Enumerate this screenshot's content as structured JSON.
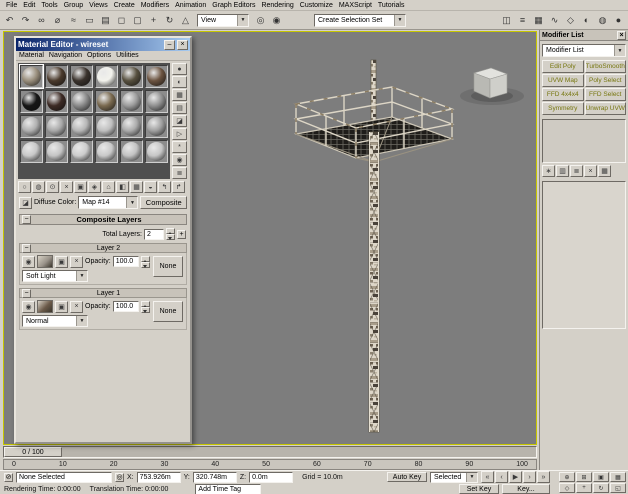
{
  "ui": {
    "dropdown_arrow": "▼"
  },
  "colors": {
    "titlebar_left": "#0a246a",
    "titlebar_right": "#a6caf0",
    "viewport_bg": "#7d7d7d",
    "active_viewport_border": "#c6c600",
    "modifier_button_text": "#77770f"
  },
  "menu": {
    "items": [
      "File",
      "Edit",
      "Tools",
      "Group",
      "Views",
      "Create",
      "Modifiers",
      "Animation",
      "Graph Editors",
      "Rendering",
      "Customize",
      "MAXScript",
      "Tutorials"
    ]
  },
  "toolbar": {
    "view_combo": "View",
    "selection_set_combo": "Create Selection Set",
    "left_icons": [
      {
        "name": "undo-icon",
        "glyph": "↶"
      },
      {
        "name": "redo-icon",
        "glyph": "↷"
      },
      {
        "name": "select-and-link-icon",
        "glyph": "∞"
      },
      {
        "name": "unlink-selection-icon",
        "glyph": "⌀"
      },
      {
        "name": "bind-to-space-warp-icon",
        "glyph": "≈"
      },
      {
        "name": "select-object-icon",
        "glyph": "▭"
      },
      {
        "name": "select-by-name-icon",
        "glyph": "▤"
      },
      {
        "name": "rectangular-selection-region-icon",
        "glyph": "◻"
      },
      {
        "name": "window-crossing-toggle-icon",
        "glyph": "▢"
      },
      {
        "name": "select-and-move-icon",
        "glyph": "+"
      },
      {
        "name": "select-and-rotate-icon",
        "glyph": "↻"
      },
      {
        "name": "select-and-scale-icon",
        "glyph": "△"
      }
    ],
    "mid_icons": [
      {
        "name": "use-pivot-point-icon",
        "glyph": "◎"
      },
      {
        "name": "select-and-manipulate-icon",
        "glyph": "◉"
      }
    ],
    "right_icons": [
      {
        "name": "mirror-icon",
        "glyph": "◫"
      },
      {
        "name": "align-icon",
        "glyph": "≡"
      },
      {
        "name": "layer-manager-icon",
        "glyph": "▦"
      },
      {
        "name": "curve-editor-icon",
        "glyph": "∿"
      },
      {
        "name": "schematic-view-icon",
        "glyph": "◇"
      },
      {
        "name": "material-editor-icon",
        "glyph": "◐"
      },
      {
        "name": "render-setup-icon",
        "glyph": "◍"
      },
      {
        "name": "quick-render-icon",
        "glyph": "●"
      }
    ]
  },
  "material_editor": {
    "title": "Material Editor - wireset",
    "min_glyph": "–",
    "close_glyph": "×",
    "collapse_glyph": "−",
    "menu": [
      "Material",
      "Navigation",
      "Options",
      "Utilities"
    ],
    "active_slot": 0,
    "slots": [
      "#9a8f7d",
      "#4a3a2c",
      "#3a322c",
      "#f2f2ec",
      "#57503f",
      "#6b5340",
      "#161616",
      "#3d2b25",
      "#8a8a8a",
      "#7a6a50",
      "#9c9c9c",
      "#909090",
      "#b0b0b0",
      "#a8a8a8",
      "#b6b6b6",
      "#bfbfbf",
      "#ababab",
      "#a0a0a0",
      "#c8c8c8",
      "#c4c4c4",
      "#cccccc",
      "#c9c9c9",
      "#c2c2c2",
      "#c6c6c6"
    ],
    "side_tools": [
      {
        "name": "sample-type-icon",
        "glyph": "●"
      },
      {
        "name": "backlight-icon",
        "glyph": "◐"
      },
      {
        "name": "background-icon",
        "glyph": "▦"
      },
      {
        "name": "sample-uv-tiling-icon",
        "glyph": "▤"
      },
      {
        "name": "video-color-check-icon",
        "glyph": "◪"
      },
      {
        "name": "make-preview-icon",
        "glyph": "▷"
      },
      {
        "name": "options-icon",
        "glyph": "*"
      },
      {
        "name": "select-by-material-icon",
        "glyph": "◉"
      },
      {
        "name": "material-map-navigator-icon",
        "glyph": "≣"
      }
    ],
    "bottom_tools": [
      {
        "name": "get-material-icon",
        "glyph": "○"
      },
      {
        "name": "put-material-to-scene-icon",
        "glyph": "◍"
      },
      {
        "name": "assign-material-to-selection-icon",
        "glyph": "⊙"
      },
      {
        "name": "reset-map-icon",
        "glyph": "×"
      },
      {
        "name": "make-material-copy-icon",
        "glyph": "▣"
      },
      {
        "name": "make-unique-icon",
        "glyph": "◈"
      },
      {
        "name": "put-to-library-icon",
        "glyph": "⌂"
      },
      {
        "name": "material-id-channel-icon",
        "glyph": "◧"
      },
      {
        "name": "show-map-in-viewport-icon",
        "glyph": "▦"
      },
      {
        "name": "show-end-result-icon",
        "glyph": "◒"
      },
      {
        "name": "go-to-parent-icon",
        "glyph": "↰"
      },
      {
        "name": "go-forward-to-sibling-icon",
        "glyph": "↱"
      }
    ],
    "map_preview_icon": "◪",
    "diffuse_label": "Diffuse Color:",
    "name_combo": "Map #14",
    "type_button": "Composite",
    "rollout_title": "Composite Layers",
    "total_layers_label": "Total Layers:",
    "total_layers_value": "2",
    "add_layer_glyph": "+",
    "icon_glyphs": {
      "visibility": "◉",
      "color_correct": "▣",
      "delete": "×"
    },
    "layers": [
      {
        "name": "Layer 2",
        "thumb": "#9a938a",
        "opacity_label": "Opacity:",
        "opacity": "100.0",
        "slot": "None",
        "blend": "Soft Light"
      },
      {
        "name": "Layer 1",
        "thumb": "#6b5a49",
        "opacity_label": "Opacity:",
        "opacity": "100.0",
        "slot": "None",
        "blend": "Normal"
      }
    ]
  },
  "command_panel": {
    "caption": "Modifier List",
    "close_glyph": "×",
    "dropdown": "Modifier List",
    "modifier_buttons": [
      "Edit Poly",
      "TurboSmooth",
      "UVW Map",
      "Poly Select",
      "FFD 4x4x4",
      "FFD Select",
      "Symmetry",
      "Unwrap UVW"
    ],
    "stack_tools": [
      {
        "name": "pin-stack-icon",
        "glyph": "∗"
      },
      {
        "name": "show-end-result-icon",
        "glyph": "▥"
      },
      {
        "name": "make-unique-icon",
        "glyph": "≣"
      },
      {
        "name": "remove-modifier-icon",
        "glyph": "×"
      },
      {
        "name": "configure-modifier-sets-icon",
        "glyph": "▦"
      }
    ]
  },
  "timeline": {
    "slider_label": "0 / 100",
    "ticks": [
      "0",
      "10",
      "20",
      "30",
      "40",
      "50",
      "60",
      "70",
      "80",
      "90",
      "100"
    ]
  },
  "status": {
    "lock_glyph": "⊘",
    "absolute_glyph": "◎",
    "selection_status": "None Selected",
    "x_label": "X:",
    "x_value": "753.926m",
    "y_label": "Y:",
    "y_value": "320.748m",
    "z_label": "Z:",
    "z_value": "0.0m",
    "grid_label": "Grid = 10.0m",
    "prompt_left": "Rendering Time: 0:00:00",
    "prompt_right": "Translation Time: 0:00:00",
    "time_tag": "Add Time Tag",
    "auto_key": "Auto Key",
    "set_key": "Set Key",
    "selection_set": "Selected",
    "key_filters": "Key...",
    "transport_icons": [
      {
        "name": "go-to-start-icon",
        "glyph": "«"
      },
      {
        "name": "previous-frame-icon",
        "glyph": "‹"
      },
      {
        "name": "play-animation-icon",
        "glyph": "▶"
      },
      {
        "name": "next-frame-icon",
        "glyph": "›"
      },
      {
        "name": "go-to-end-icon",
        "glyph": "»"
      }
    ],
    "nav_icons": [
      {
        "name": "zoom-icon",
        "glyph": "⊕"
      },
      {
        "name": "zoom-all-icon",
        "glyph": "⊞"
      },
      {
        "name": "zoom-extents-icon",
        "glyph": "▣"
      },
      {
        "name": "zoom-extents-all-icon",
        "glyph": "▦"
      },
      {
        "name": "field-of-view-icon",
        "glyph": "◇"
      },
      {
        "name": "pan-icon",
        "glyph": "+"
      },
      {
        "name": "arc-rotate-icon",
        "glyph": "↻"
      },
      {
        "name": "maximize-viewport-icon",
        "glyph": "◱"
      }
    ]
  }
}
